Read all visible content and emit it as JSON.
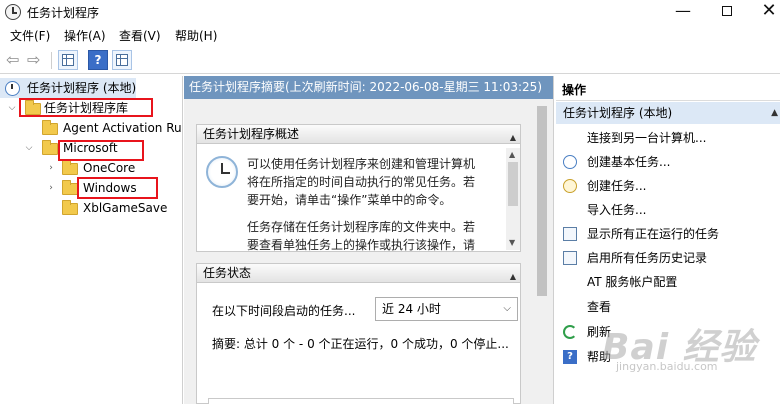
{
  "window": {
    "title": "任务计划程序",
    "minimize": "—",
    "close": "✕"
  },
  "menu": [
    "文件(F)",
    "操作(A)",
    "查看(V)",
    "帮助(H)"
  ],
  "toolbar": {
    "back": "⇦",
    "forward": "⇨",
    "help": "?"
  },
  "tree": {
    "root": "任务计划程序 (本地)",
    "library": "任务计划程序库",
    "agent": "Agent Activation Ru",
    "microsoft": "Microsoft",
    "onecore": "OneCore",
    "windows": "Windows",
    "xbl": "XblGameSave"
  },
  "middle": {
    "header": "任务计划程序摘要(上次刷新时间: 2022-06-08-星期三 11:03:25)",
    "overview_title": "任务计划程序概述",
    "overview_p1": "可以使用任务计划程序来创建和管理计算机将在所指定的时间自动执行的常见任务。若要开始，请单击“操作”菜单中的命令。",
    "overview_p2": "任务存储在任务计划程序库的文件夹中。若要查看单独任务上的操作或执行该操作，请",
    "status_title": "任务状态",
    "status_label": "在以下时间段启动的任务...",
    "period": "近 24 小时",
    "summary": "摘要: 总计 0 个 - 0 个正在运行，0 个成功，0 个停止..."
  },
  "actions": {
    "title": "操作",
    "subtitle": "任务计划程序 (本地)",
    "items": [
      {
        "label": "连接到另一台计算机...",
        "icon": "none"
      },
      {
        "label": "创建基本任务...",
        "icon": "clock-icon"
      },
      {
        "label": "创建任务...",
        "icon": "clock-yellow-icon"
      },
      {
        "label": "导入任务...",
        "icon": "none"
      },
      {
        "label": "显示所有正在运行的任务",
        "icon": "list-icon"
      },
      {
        "label": "启用所有任务历史记录",
        "icon": "list-icon"
      },
      {
        "label": "AT 服务帐户配置",
        "icon": "none"
      },
      {
        "label": "查看",
        "icon": "none"
      },
      {
        "label": "刷新",
        "icon": "refresh-icon"
      },
      {
        "label": "帮助",
        "icon": "help-icon"
      }
    ]
  },
  "watermark": {
    "brand": "Bai 经验",
    "url": "jingyan.baidu.com"
  },
  "colors": {
    "header_blue": "#6f95be",
    "selection": "#dce8f6",
    "highlight_box": "#e8141c"
  }
}
